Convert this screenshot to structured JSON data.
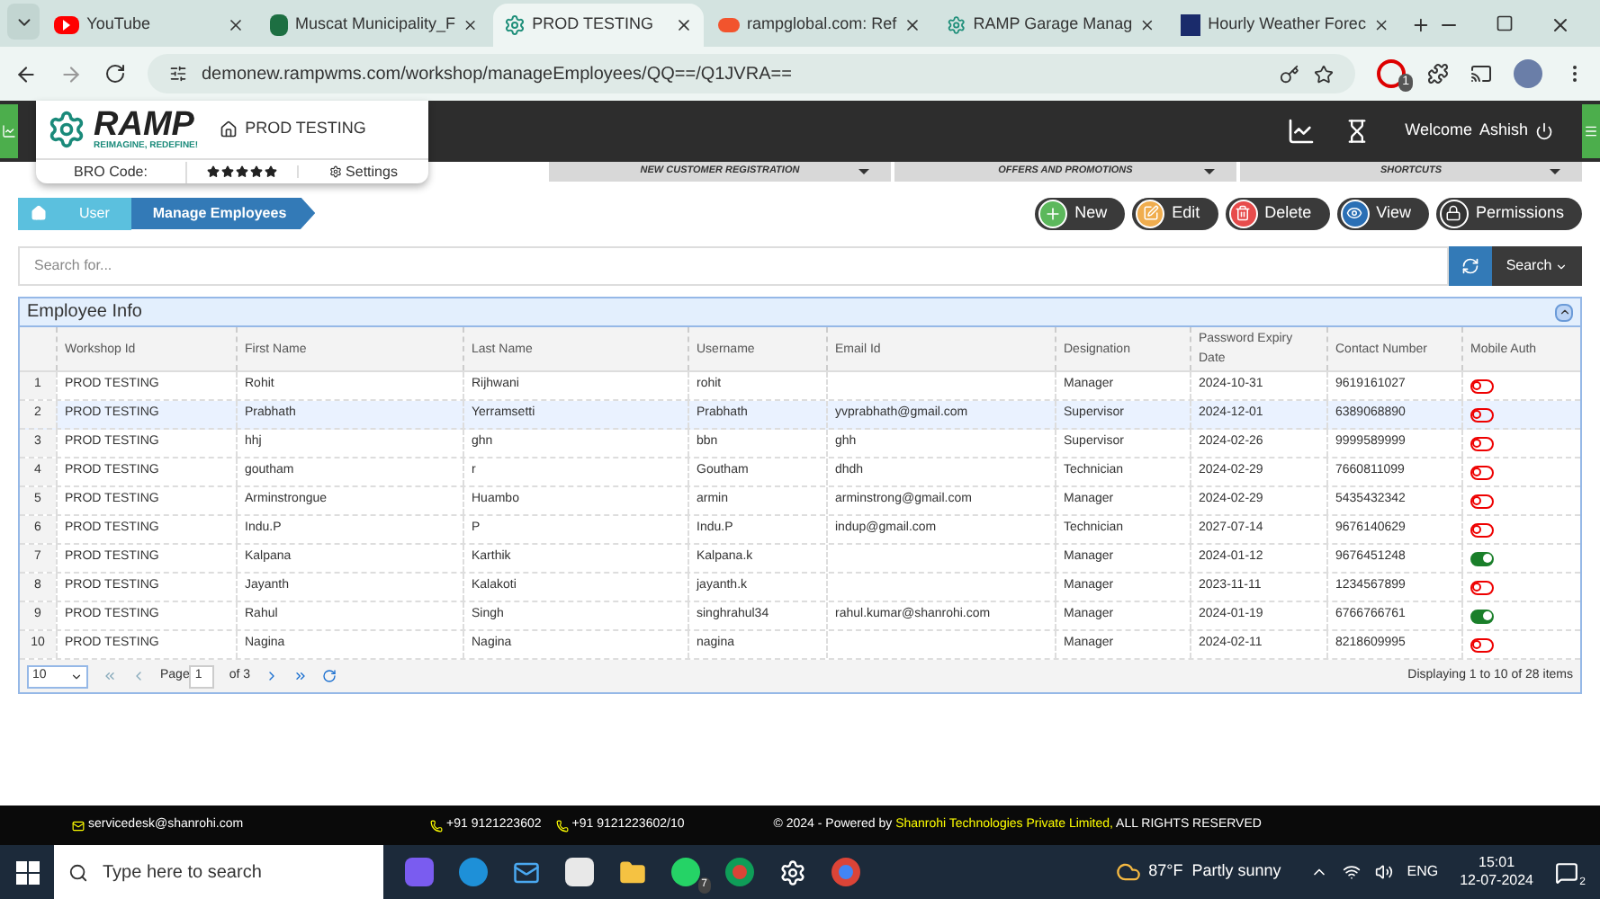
{
  "browser": {
    "tabs": [
      {
        "title": "YouTube",
        "selected": false
      },
      {
        "title": "Muscat Municipality_F",
        "selected": false
      },
      {
        "title": "PROD TESTING",
        "selected": true
      },
      {
        "title": "rampglobal.com: Ref",
        "selected": false
      },
      {
        "title": "RAMP Garage Manag",
        "selected": false
      },
      {
        "title": "Hourly Weather Forec",
        "selected": false
      }
    ],
    "url": "demonew.rampwms.com/workshop/manageEmployees/QQ==/Q1JVRA==",
    "extension_badge": "1"
  },
  "app": {
    "brand": "RAMP",
    "tagline": "REIMAGINE, REDEFINE!",
    "workshop": "PROD TESTING",
    "bro_code": "BRO Code:",
    "stars": 5,
    "settings": "Settings",
    "welcome": "Welcome",
    "user": "Ashish",
    "menus": [
      "NEW CUSTOMER REGISTRATION",
      "OFFERS AND PROMOTIONS",
      "SHORTCUTS"
    ]
  },
  "breadcrumb": [
    "User",
    "Manage Employees"
  ],
  "actions": [
    {
      "label": "New",
      "kind": "new"
    },
    {
      "label": "Edit",
      "kind": "edit"
    },
    {
      "label": "Delete",
      "kind": "delete"
    },
    {
      "label": "View",
      "kind": "view"
    },
    {
      "label": "Permissions",
      "kind": "permissions"
    }
  ],
  "search": {
    "placeholder": "Search for...",
    "button": "Search"
  },
  "panel": {
    "title": "Employee Info",
    "columns": [
      "Workshop Id",
      "First Name",
      "Last Name",
      "Username",
      "Email Id",
      "Designation",
      "Password Expiry Date",
      "Contact Number",
      "Mobile Auth"
    ],
    "rows": [
      {
        "num": "1",
        "cells": [
          "PROD TESTING",
          "Rohit",
          "Rijhwani",
          "rohit",
          "",
          "Manager",
          "2024-10-31",
          "9619161027"
        ],
        "mobile_auth": false,
        "selected": false
      },
      {
        "num": "2",
        "cells": [
          "PROD TESTING",
          "Prabhath",
          "Yerramsetti",
          "Prabhath",
          "yvprabhath@gmail.com",
          "Supervisor",
          "2024-12-01",
          "6389068890"
        ],
        "mobile_auth": false,
        "selected": true
      },
      {
        "num": "3",
        "cells": [
          "PROD TESTING",
          "hhj",
          "ghn",
          "bbn",
          "ghh",
          "Supervisor",
          "2024-02-26",
          "9999589999"
        ],
        "mobile_auth": false,
        "selected": false
      },
      {
        "num": "4",
        "cells": [
          "PROD TESTING",
          "goutham",
          "r",
          "Goutham",
          "dhdh",
          "Technician",
          "2024-02-29",
          "7660811099"
        ],
        "mobile_auth": false,
        "selected": false
      },
      {
        "num": "5",
        "cells": [
          "PROD TESTING",
          "Arminstrongue",
          "Huambo",
          "armin",
          "arminstrong@gmail.com",
          "Manager",
          "2024-02-29",
          "5435432342"
        ],
        "mobile_auth": false,
        "selected": false
      },
      {
        "num": "6",
        "cells": [
          "PROD TESTING",
          "Indu.P",
          "P",
          "Indu.P",
          "indup@gmail.com",
          "Technician",
          "2027-07-14",
          "9676140629"
        ],
        "mobile_auth": false,
        "selected": false
      },
      {
        "num": "7",
        "cells": [
          "PROD TESTING",
          "Kalpana",
          "Karthik",
          "Kalpana.k",
          "",
          "Manager",
          "2024-01-12",
          "9676451248"
        ],
        "mobile_auth": true,
        "selected": false
      },
      {
        "num": "8",
        "cells": [
          "PROD TESTING",
          "Jayanth",
          "Kalakoti",
          "jayanth.k",
          "",
          "Manager",
          "2023-11-11",
          "1234567899"
        ],
        "mobile_auth": false,
        "selected": false
      },
      {
        "num": "9",
        "cells": [
          "PROD TESTING",
          "Rahul",
          "Singh",
          "singhrahul34",
          "rahul.kumar@shanrohi.com",
          "Manager",
          "2024-01-19",
          "6766766761"
        ],
        "mobile_auth": true,
        "selected": false
      },
      {
        "num": "10",
        "cells": [
          "PROD TESTING",
          "Nagina",
          "Nagina",
          "nagina",
          "",
          "Manager",
          "2024-02-11",
          "8218609995"
        ],
        "mobile_auth": false,
        "selected": false
      }
    ],
    "pager": {
      "page_size": "10",
      "page_label": "Page",
      "page": "1",
      "of": "of 3",
      "display": "Displaying 1 to 10 of 28 items"
    }
  },
  "footer": {
    "email": "servicedesk@shanrohi.com",
    "phone1": "+91 9121223602",
    "phone2": "+91 9121223602/10",
    "copyright_prefix": "© 2024 - Powered by",
    "company": "Shanrohi Technologies Private Limited,",
    "copyright_suffix": "ALL RIGHTS RESERVED"
  },
  "taskbar": {
    "search_placeholder": "Type here to search",
    "whatsapp_badge": "7",
    "weather": "87°F  Partly sunny",
    "lang": "ENG",
    "time": "15:01",
    "date": "12-07-2024",
    "notifications": "2"
  }
}
